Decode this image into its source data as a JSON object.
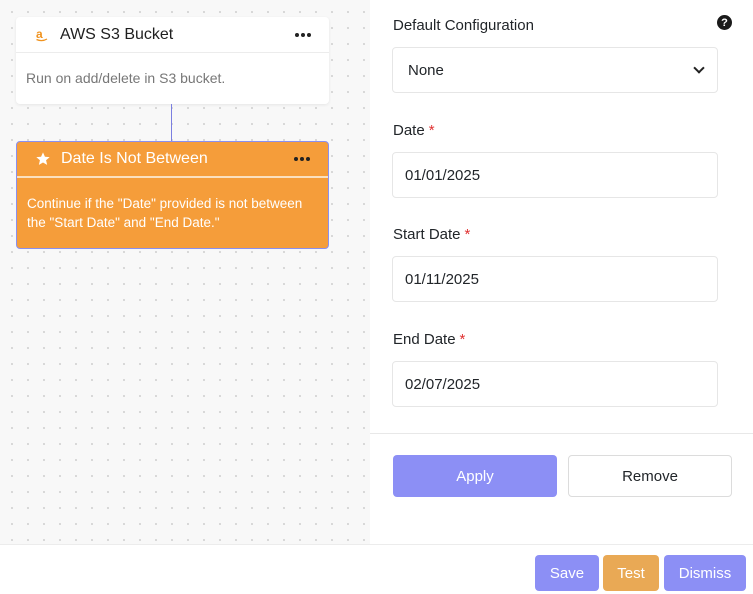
{
  "canvas": {
    "trigger_node": {
      "title": "AWS S3 Bucket",
      "icon": "amazon-icon",
      "description": "Run on add/delete in S3 bucket."
    },
    "condition_node": {
      "title": "Date Is Not Between",
      "icon": "star-icon",
      "description": "Continue if the \"Date\" provided is not between the \"Start Date\" and \"End Date.\"",
      "color": "#f59d3a"
    }
  },
  "panel": {
    "default_config": {
      "label": "Default Configuration",
      "selected": "None"
    },
    "date": {
      "label": "Date",
      "required_mark": "*",
      "value": "01/01/2025"
    },
    "start_date": {
      "label": "Start Date",
      "required_mark": "*",
      "value": "01/11/2025"
    },
    "end_date": {
      "label": "End Date",
      "required_mark": "*",
      "value": "02/07/2025"
    },
    "apply_label": "Apply",
    "remove_label": "Remove",
    "help_glyph": "?"
  },
  "footer": {
    "save_label": "Save",
    "test_label": "Test",
    "dismiss_label": "Dismiss"
  },
  "colors": {
    "accent": "#8c8ff5",
    "test": "#e9a955",
    "required": "#e03131"
  }
}
